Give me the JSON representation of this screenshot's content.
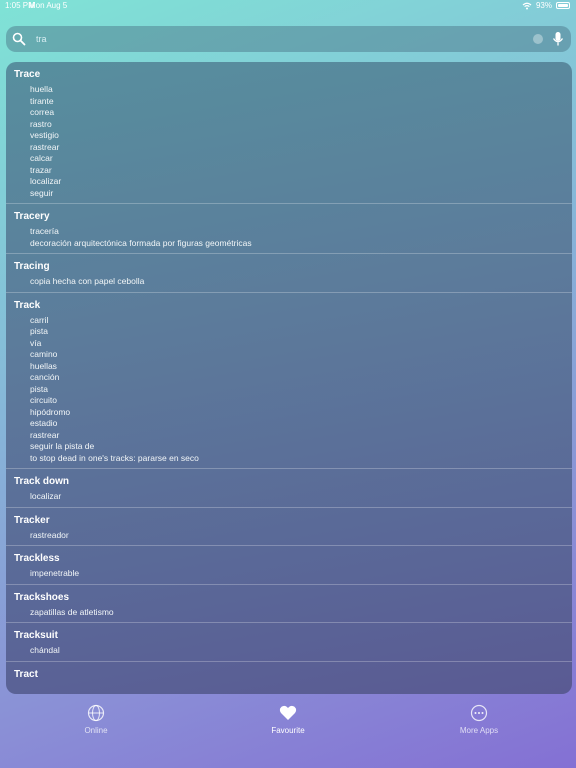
{
  "status": {
    "time": "1:05 PM",
    "date": "Mon Aug 5",
    "battery": "93%"
  },
  "search": {
    "value": "tra",
    "placeholder": ""
  },
  "entries": [
    {
      "word": "Trace",
      "translations": [
        "huella",
        "tirante",
        "correa",
        "rastro",
        "vestigio",
        "rastrear",
        "calcar",
        "trazar",
        "localizar",
        "seguir"
      ]
    },
    {
      "word": "Tracery",
      "translations": [
        "tracería",
        "decoración arquitectónica formada por figuras geométricas"
      ]
    },
    {
      "word": "Tracing",
      "translations": [
        "copia hecha con papel cebolla"
      ]
    },
    {
      "word": "Track",
      "translations": [
        "carril",
        "pista",
        "vía",
        "camino",
        "huellas",
        "canción",
        "pista",
        "circuito",
        "hipódromo",
        "estadio",
        "rastrear",
        "seguir la pista de",
        "to stop dead in one's tracks: pararse en seco"
      ]
    },
    {
      "word": "Track down",
      "translations": [
        "localizar"
      ]
    },
    {
      "word": "Tracker",
      "translations": [
        "rastreador"
      ]
    },
    {
      "word": "Trackless",
      "translations": [
        "impenetrable"
      ]
    },
    {
      "word": "Trackshoes",
      "translations": [
        "zapatillas de atletismo"
      ]
    },
    {
      "word": "Tracksuit",
      "translations": [
        "chándal"
      ]
    },
    {
      "word": "Tract",
      "translations": []
    }
  ],
  "tabs": {
    "online": "Online",
    "favourite": "Favourite",
    "more": "More Apps"
  },
  "icons": {
    "search": "search-icon",
    "mic": "microphone-icon",
    "clear": "clear-icon",
    "online": "globe-icon",
    "favourite": "heart-icon",
    "more": "more-dots-icon"
  }
}
